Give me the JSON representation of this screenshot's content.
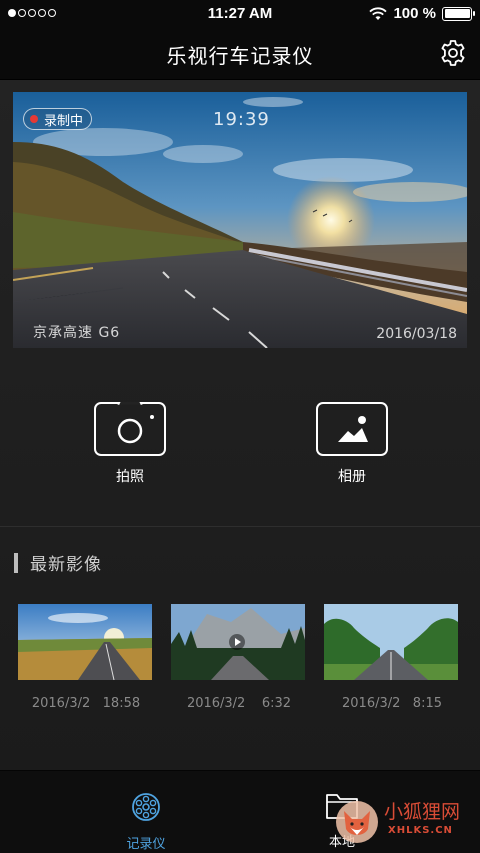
{
  "status_bar": {
    "time": "11:27 AM",
    "battery": "100 %",
    "battery_level": 1.0,
    "signal_bars_filled": 1,
    "signal_bars_total": 5
  },
  "nav": {
    "title": "乐视行车记录仪",
    "settings_icon": "gear-icon"
  },
  "live_view": {
    "recording_label": "录制中",
    "time": "19:39",
    "location": "京承高速 G6",
    "date": "2016/03/18"
  },
  "actions": {
    "photo_label": "拍照",
    "photo_icon": "camera-icon",
    "album_label": "相册",
    "album_icon": "gallery-icon"
  },
  "latest": {
    "title": "最新影像",
    "items": [
      {
        "date": "2016/3/2",
        "time": "18:58",
        "type": "photo"
      },
      {
        "date": "2016/3/2",
        "time": "6:32",
        "type": "video"
      },
      {
        "date": "2016/3/2",
        "time": "8:15",
        "type": "photo"
      }
    ]
  },
  "tab_bar": {
    "tabs": [
      {
        "label": "记录仪",
        "icon": "recorder-icon",
        "active": true
      },
      {
        "label": "本地",
        "icon": "folder-icon",
        "active": false
      }
    ]
  },
  "watermark": {
    "text_cn": "小狐狸网",
    "text_en": "XHLKS.CN"
  },
  "colors": {
    "accent": "#4fa3e0",
    "rec_dot": "#e53935",
    "watermark": "#d94c36"
  }
}
